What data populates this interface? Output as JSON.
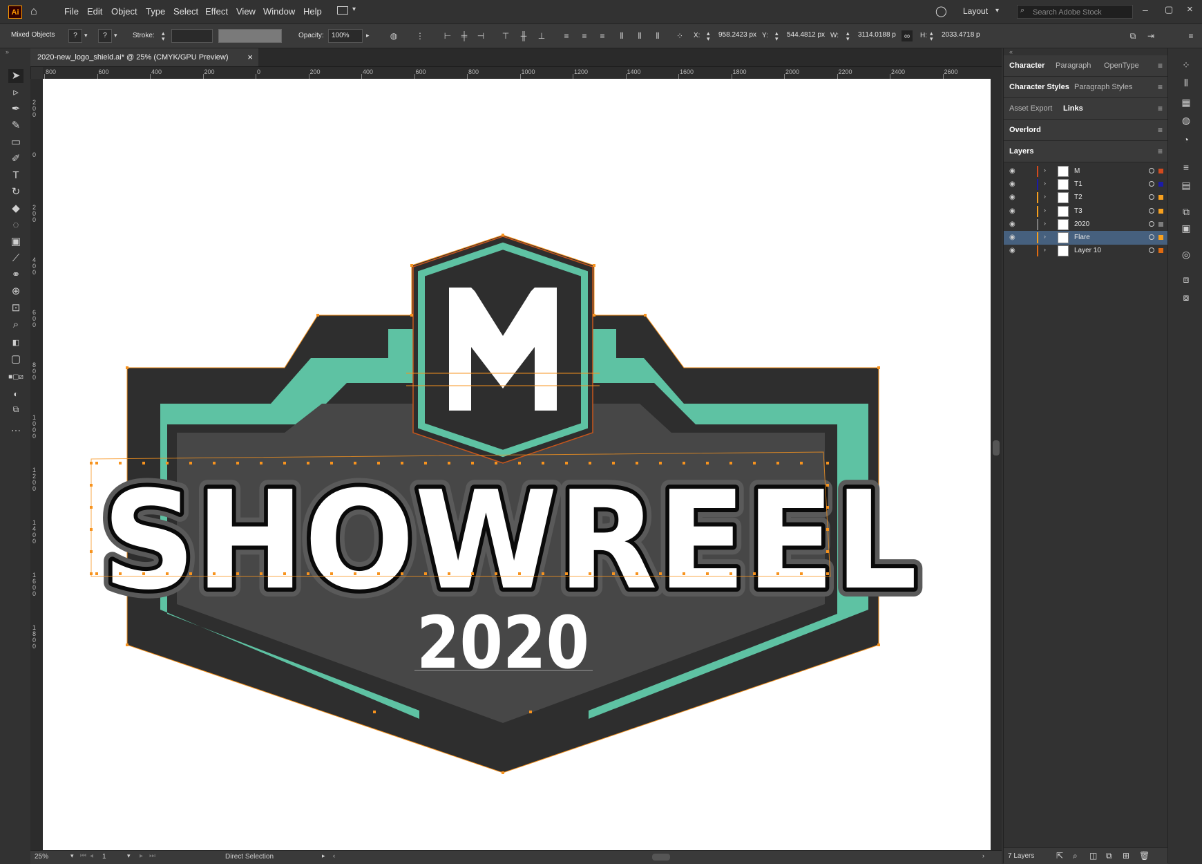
{
  "app": {
    "logo": "Ai"
  },
  "menu": {
    "items": [
      "File",
      "Edit",
      "Object",
      "Type",
      "Select",
      "Effect",
      "View",
      "Window",
      "Help"
    ],
    "workspace": "Layout",
    "search_placeholder": "Search Adobe Stock"
  },
  "control": {
    "selection_label": "Mixed Objects",
    "stroke_label": "Stroke:",
    "opacity_label": "Opacity:",
    "opacity_value": "100%",
    "x_label": "X:",
    "x_value": "958.2423 px",
    "y_label": "Y:",
    "y_value": "544.4812 px",
    "w_label": "W:",
    "w_value": "3114.0188 p",
    "h_label": "H:",
    "h_value": "2033.4718 p",
    "unknown_glyph": "?"
  },
  "document": {
    "tab_title": "2020-new_logo_shield.ai* @ 25% (CMYK/GPU Preview)",
    "close_glyph": "×"
  },
  "ruler": {
    "h_ticks": [
      "800",
      "600",
      "400",
      "200",
      "0",
      "200",
      "400",
      "600",
      "800",
      "1000",
      "1200",
      "1400",
      "1600",
      "1800",
      "2000",
      "2200",
      "2400",
      "2600"
    ],
    "v_ticks": [
      "2\n0\n0",
      "0",
      "2\n0\n0",
      "4\n0\n0",
      "6\n0\n0",
      "8\n0\n0",
      "1\n0\n0\n0",
      "1\n2\n0\n0",
      "1\n4\n0\n0",
      "1\n6\n0\n0",
      "1\n8\n0\n0"
    ]
  },
  "artwork": {
    "title_text": "SHOWREEL",
    "year_text": "2020",
    "monogram": "M",
    "colors": {
      "dark": "#2e2e2e",
      "mid": "#474747",
      "teal": "#5ec2a3",
      "white": "#ffffff",
      "path": "#f7931e",
      "anchor": "#1a1a8c"
    }
  },
  "status": {
    "zoom": "25%",
    "artboard_number": "1",
    "tool_name": "Direct Selection"
  },
  "panels": {
    "row1": {
      "tabs": [
        "Character",
        "Paragraph",
        "OpenType"
      ],
      "active": 0
    },
    "row2": {
      "tabs": [
        "Character Styles",
        "Paragraph Styles"
      ],
      "active": 0
    },
    "row3": {
      "tabs": [
        "Asset Export",
        "Links"
      ],
      "active": 1
    },
    "row4": {
      "tabs": [
        "Overlord"
      ],
      "active": 0
    },
    "row5": {
      "tabs": [
        "Layers"
      ],
      "active": 0
    },
    "menu_glyph": "≡"
  },
  "layers": {
    "items": [
      {
        "name": "M",
        "color": "#d24a1e",
        "selected": false
      },
      {
        "name": "T1",
        "color": "#1b1ba8",
        "selected": false
      },
      {
        "name": "T2",
        "color": "#f7a01e",
        "selected": false
      },
      {
        "name": "T3",
        "color": "#f7a01e",
        "selected": false
      },
      {
        "name": "2020",
        "color": "#7d7d7d",
        "selected": false
      },
      {
        "name": "Flare",
        "color": "#f7a01e",
        "selected": true
      },
      {
        "name": "Layer 10",
        "color": "#e06a10",
        "selected": false
      }
    ],
    "count_label": "7 Layers"
  }
}
